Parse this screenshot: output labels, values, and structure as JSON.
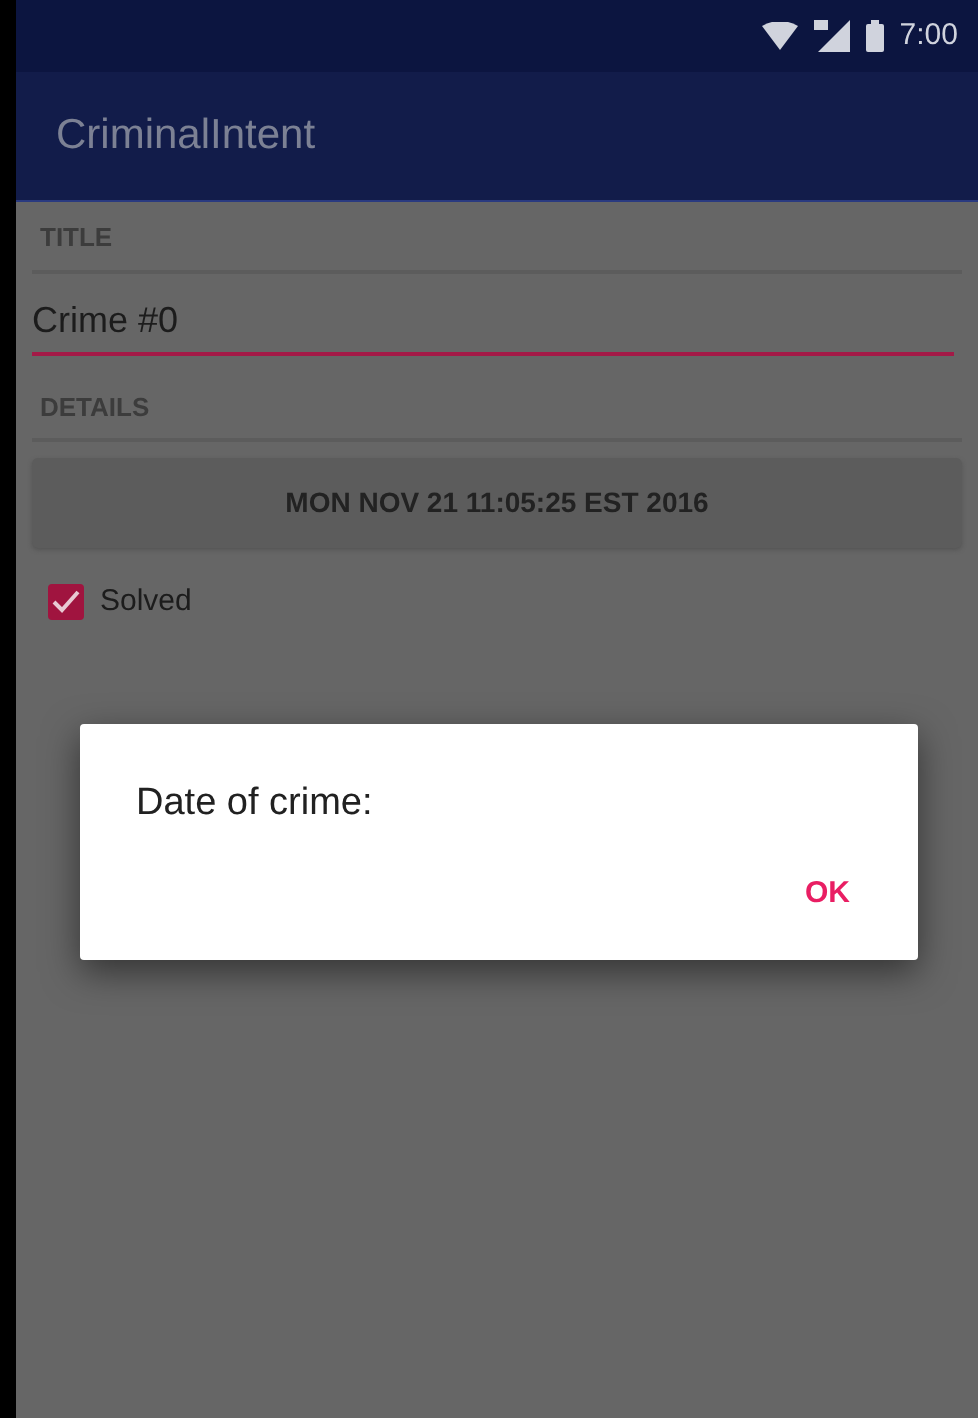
{
  "status_bar": {
    "time": "7:00"
  },
  "app_bar": {
    "title": "CriminalIntent"
  },
  "form": {
    "title_label": "TITLE",
    "title_field": {
      "value": "Crime #0"
    },
    "details_label": "DETAILS",
    "date_button": "MON NOV 21 11:05:25 EST 2016",
    "solved": {
      "label": "Solved",
      "checked": true
    }
  },
  "dialog": {
    "title": "Date of crime:",
    "buttons": [
      "OK"
    ]
  }
}
